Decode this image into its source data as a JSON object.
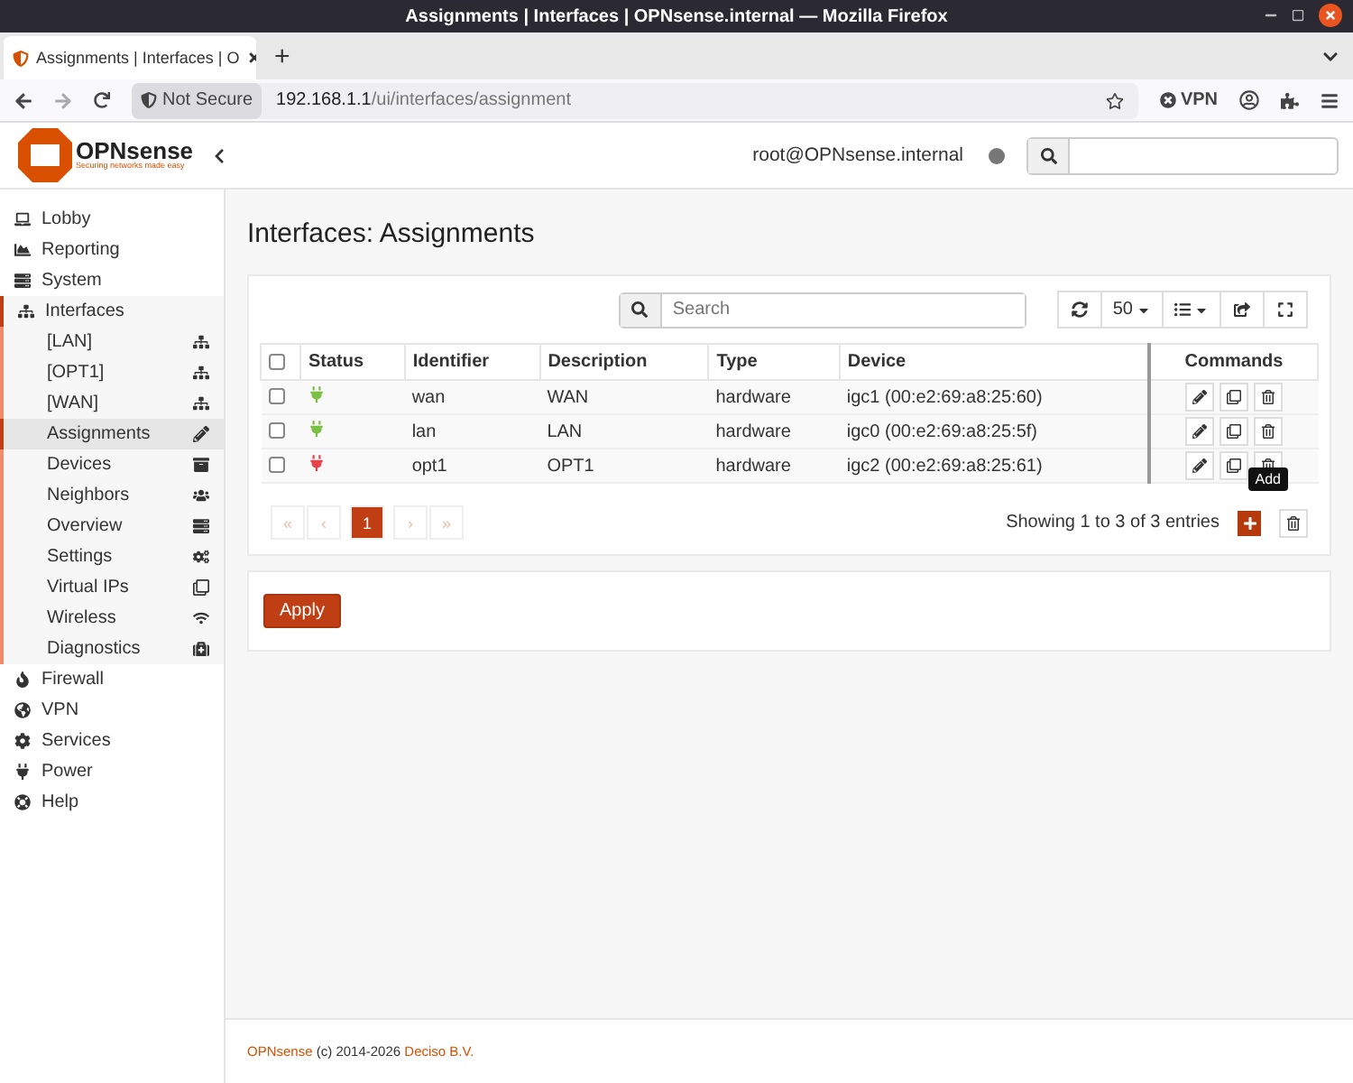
{
  "window": {
    "title": "Assignments | Interfaces | OPNsense.internal — Mozilla Firefox"
  },
  "browser": {
    "tab_title": "Assignments | Interfaces | O",
    "new_tab": "+",
    "security": "Not Secure",
    "url": {
      "host": "192.168.1.1",
      "path": "/ui/interfaces/assignment"
    },
    "vpn": "VPN"
  },
  "header": {
    "brand": "OPNsense",
    "tagline": "Securing networks made easy",
    "user": "root@OPNsense.internal"
  },
  "sidebar": {
    "items": [
      {
        "label": "Lobby"
      },
      {
        "label": "Reporting"
      },
      {
        "label": "System"
      },
      {
        "label": "Interfaces",
        "expanded": true,
        "children": [
          {
            "label": "[LAN]",
            "selected": false
          },
          {
            "label": "[OPT1]",
            "selected": false
          },
          {
            "label": "[WAN]",
            "selected": false
          },
          {
            "label": "Assignments",
            "selected": true
          },
          {
            "label": "Devices",
            "selected": false
          },
          {
            "label": "Neighbors",
            "selected": false
          },
          {
            "label": "Overview",
            "selected": false
          },
          {
            "label": "Settings",
            "selected": false
          },
          {
            "label": "Virtual IPs",
            "selected": false
          },
          {
            "label": "Wireless",
            "selected": false
          },
          {
            "label": "Diagnostics",
            "selected": false
          }
        ]
      },
      {
        "label": "Firewall"
      },
      {
        "label": "VPN"
      },
      {
        "label": "Services"
      },
      {
        "label": "Power"
      },
      {
        "label": "Help"
      }
    ]
  },
  "page_title": "Interfaces: Assignments",
  "grid": {
    "search": {
      "placeholder": "Search"
    },
    "page_size": "50",
    "select_all_checked": false,
    "columns": [
      "Status",
      "Identifier",
      "Description",
      "Type",
      "Device",
      "Commands"
    ],
    "rows": [
      {
        "checked": false,
        "color": "#7cc043",
        "identifier": "wan",
        "description": "WAN",
        "type": "hardware",
        "device": "igc1 (00:e2:69:a8:25:60)"
      },
      {
        "checked": false,
        "color": "#7cc043",
        "identifier": "lan",
        "description": "LAN",
        "type": "hardware",
        "device": "igc0 (00:e2:69:a8:25:5f)"
      },
      {
        "checked": false,
        "color": "#e5454a",
        "identifier": "opt1",
        "description": "OPT1",
        "type": "hardware",
        "device": "igc2 (00:e2:69:a8:25:61)"
      }
    ],
    "pagination": [
      {
        "label": "«",
        "selected": false,
        "disabled": true
      },
      {
        "label": "‹",
        "selected": false,
        "disabled": true
      },
      {
        "label": "1",
        "selected": true,
        "disabled": false
      },
      {
        "label": "›",
        "selected": false,
        "disabled": true
      },
      {
        "label": "»",
        "selected": false,
        "disabled": true
      }
    ],
    "info": "Showing 1 to 3 of 3 entries",
    "tooltip": "Add"
  },
  "apply_button": "Apply",
  "footer": {
    "brand": "OPNsense",
    "text": "(c) 2014-2026",
    "company": "Deciso B.V."
  }
}
